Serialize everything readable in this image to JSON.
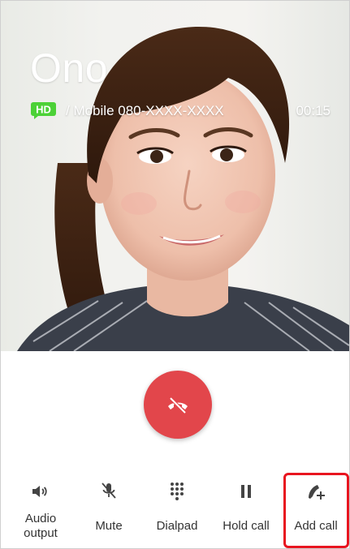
{
  "call": {
    "contact_name": "Ono",
    "hd_badge": "HD",
    "detail": "/ Mobile 080-XXXX-XXXX",
    "timer": "00:15"
  },
  "buttons": {
    "end_call_icon": "end-call-icon"
  },
  "controls": [
    {
      "label": "Audio output",
      "line1": "Audio",
      "line2": "output",
      "icon": "speaker-icon"
    },
    {
      "label": "Mute",
      "icon": "mic-off-icon"
    },
    {
      "label": "Dialpad",
      "icon": "dialpad-icon"
    },
    {
      "label": "Hold call",
      "icon": "pause-icon"
    },
    {
      "label": "Add call",
      "icon": "add-call-icon"
    }
  ],
  "colors": {
    "end_call": "#e2464b",
    "hd_badge": "#4cd137",
    "highlight": "#e8141f"
  }
}
